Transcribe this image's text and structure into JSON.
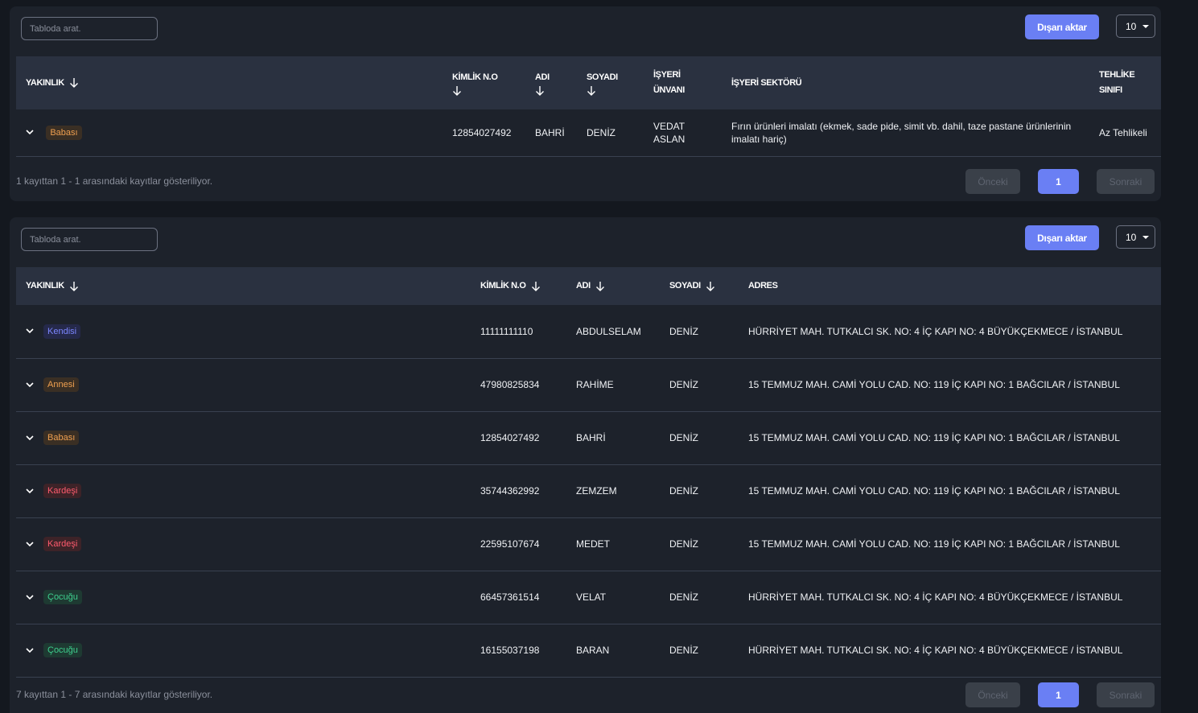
{
  "table1": {
    "search_placeholder": "Tabloda arat.",
    "export_label": "Dışarı aktar",
    "page_size": "10",
    "headers": {
      "yakinlik": "YAKINLIK",
      "kimlik": "KİMLİK N.O",
      "adi": "ADI",
      "soyadi": "SOYADI",
      "isyeri_unvani_1": "İŞYERİ",
      "isyeri_unvani_2": "ÜNVANI",
      "isyeri_sektoru": "İŞYERİ SEKTÖRÜ",
      "tehlike_1": "TEHLİKE",
      "tehlike_2": "SINIFI"
    },
    "rows": [
      {
        "yakinlik": "Babası",
        "kimlik": "12854027492",
        "adi": "BAHRİ",
        "soyadi": "DENİZ",
        "unvan_1": "VEDAT",
        "unvan_2": "ASLAN",
        "sektor": "Fırın ürünleri imalatı (ekmek, sade pide, simit vb. dahil, taze pastane ürünlerinin imalatı hariç)",
        "tehlike": "Az Tehlikeli"
      }
    ],
    "info": "1 kayıttan 1 - 1 arasındaki kayıtlar gösteriliyor.",
    "prev_label": "Önceki",
    "page_number": "1",
    "next_label": "Sonraki"
  },
  "table2": {
    "search_placeholder": "Tabloda arat.",
    "export_label": "Dışarı aktar",
    "page_size": "10",
    "headers": {
      "yakinlik": "YAKINLIK",
      "kimlik": "KİMLİK N.O",
      "adi": "ADI",
      "soyadi": "SOYADI",
      "adres": "ADRES"
    },
    "rows": [
      {
        "yakinlik": "Kendisi",
        "kimlik": "11111111110",
        "adi": "ABDULSELAM",
        "soyadi": "DENİZ",
        "adres": "HÜRRİYET MAH. TUTKALCI SK. NO: 4 İÇ KAPI NO: 4 BÜYÜKÇEKMECE / İSTANBUL"
      },
      {
        "yakinlik": "Annesi",
        "kimlik": "47980825834",
        "adi": "RAHİME",
        "soyadi": "DENİZ",
        "adres": "15 TEMMUZ MAH. CAMİ YOLU CAD. NO: 119 İÇ KAPI NO: 1 BAĞCILAR / İSTANBUL"
      },
      {
        "yakinlik": "Babası",
        "kimlik": "12854027492",
        "adi": "BAHRİ",
        "soyadi": "DENİZ",
        "adres": "15 TEMMUZ MAH. CAMİ YOLU CAD. NO: 119 İÇ KAPI NO: 1 BAĞCILAR / İSTANBUL"
      },
      {
        "yakinlik": "Kardeşi",
        "kimlik": "35744362992",
        "adi": "ZEMZEM",
        "soyadi": "DENİZ",
        "adres": "15 TEMMUZ MAH. CAMİ YOLU CAD. NO: 119 İÇ KAPI NO: 1 BAĞCILAR / İSTANBUL"
      },
      {
        "yakinlik": "Kardeşi",
        "kimlik": "22595107674",
        "adi": "MEDET",
        "soyadi": "DENİZ",
        "adres": "15 TEMMUZ MAH. CAMİ YOLU CAD. NO: 119 İÇ KAPI NO: 1 BAĞCILAR / İSTANBUL"
      },
      {
        "yakinlik": "Çocuğu",
        "kimlik": "66457361514",
        "adi": "VELAT",
        "soyadi": "DENİZ",
        "adres": "HÜRRİYET MAH. TUTKALCI SK. NO: 4 İÇ KAPI NO: 4 BÜYÜKÇEKMECE / İSTANBUL"
      },
      {
        "yakinlik": "Çocuğu",
        "kimlik": "16155037198",
        "adi": "BARAN",
        "soyadi": "DENİZ",
        "adres": "HÜRRİYET MAH. TUTKALCI SK. NO: 4 İÇ KAPI NO: 4 BÜYÜKÇEKMECE / İSTANBUL"
      }
    ],
    "info": "7 kayıttan 1 - 7 arasındaki kayıtlar gösteriliyor.",
    "prev_label": "Önceki",
    "page_number": "1",
    "next_label": "Sonraki"
  },
  "badge_colors": {
    "Babası": "b-orange",
    "Annesi": "b-orange",
    "Kendisi": "b-blue",
    "Kardeşi": "b-red",
    "Çocuğu": "b-green"
  },
  "icons": {
    "sort": "arrow-down-icon",
    "expand": "chevron-down-icon",
    "dropdown": "caret-down-icon"
  }
}
